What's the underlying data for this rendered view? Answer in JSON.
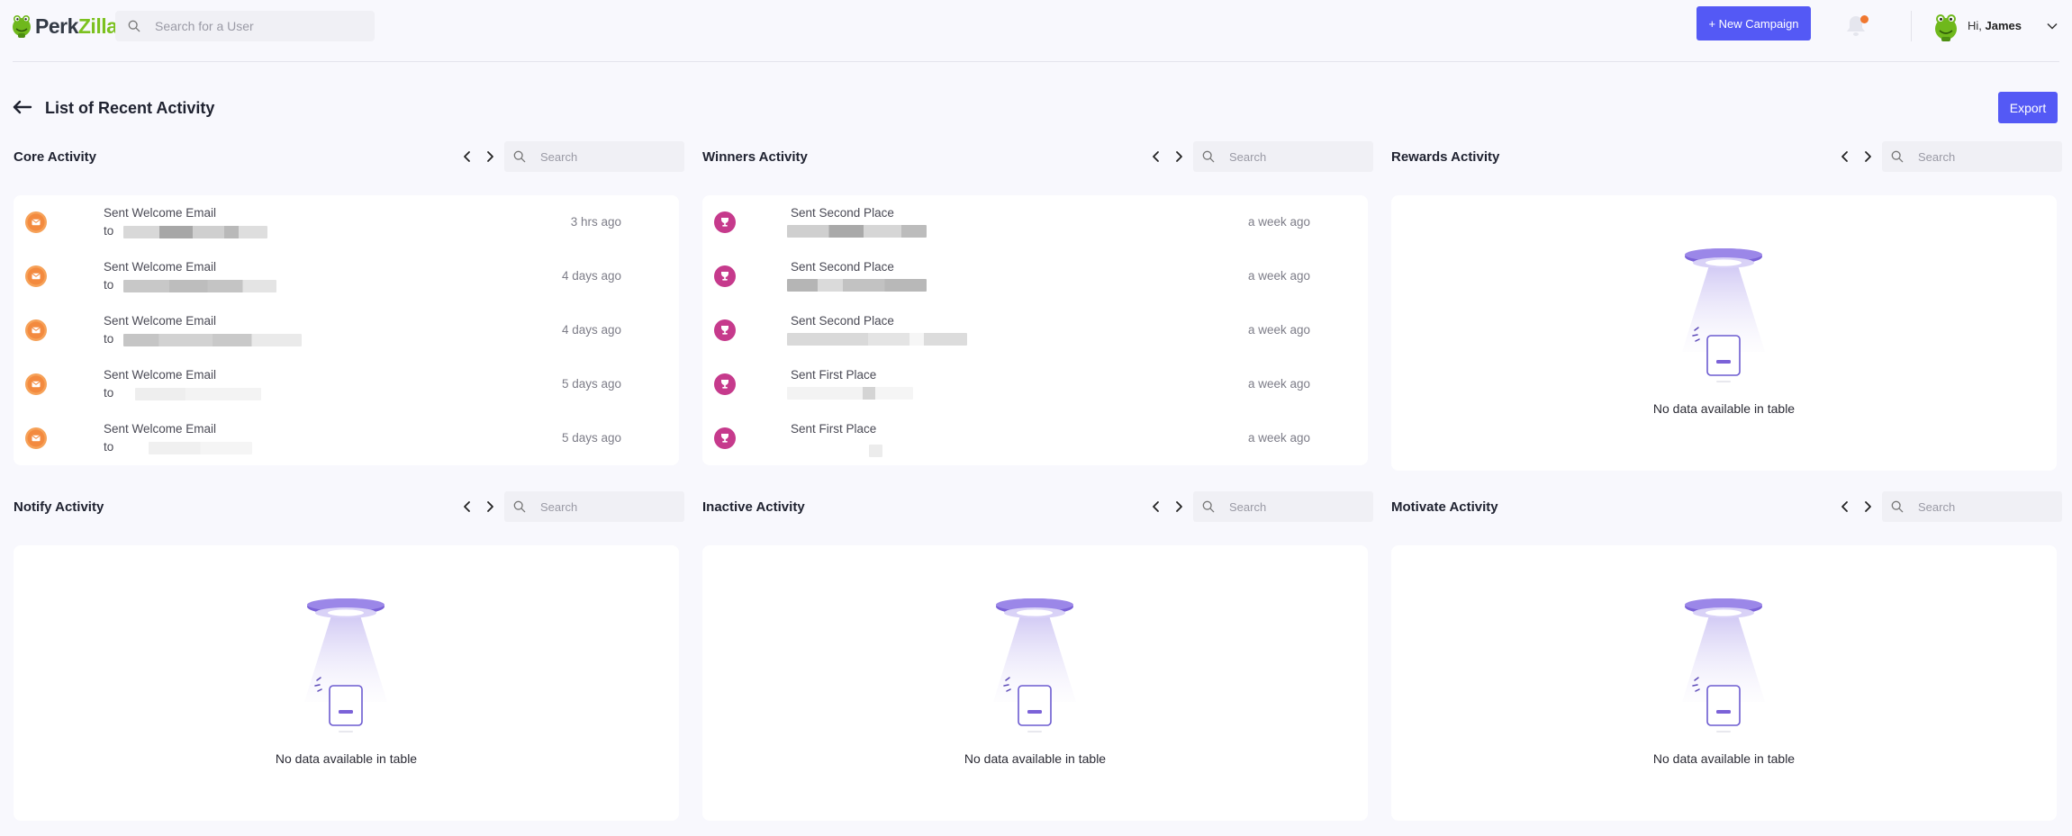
{
  "header": {
    "logo_part1": "Perk",
    "logo_part2": "Zilla",
    "search_placeholder": "Search for a User",
    "new_campaign_label": "+ New Campaign",
    "greeting": "Hi,",
    "user_name": "James",
    "accent_color": "#5459f5",
    "notification_dot_color": "#f0772f"
  },
  "page": {
    "title": "List of Recent Activity",
    "export_label": "Export"
  },
  "panels": {
    "core": {
      "title": "Core Activity",
      "search_placeholder": "Search",
      "badge_icon": "email-icon",
      "badge_color": "#f6a259",
      "rows": [
        {
          "title": "Sent Welcome Email",
          "sub": "to",
          "time": "3 hrs ago"
        },
        {
          "title": "Sent Welcome Email",
          "sub": "to",
          "time": "4 days ago"
        },
        {
          "title": "Sent Welcome Email",
          "sub": "to",
          "time": "4 days ago"
        },
        {
          "title": "Sent Welcome Email",
          "sub": "to",
          "time": "5 days ago"
        },
        {
          "title": "Sent Welcome Email",
          "sub": "to",
          "time": "5 days ago"
        }
      ]
    },
    "winners": {
      "title": "Winners Activity",
      "search_placeholder": "Search",
      "badge_icon": "trophy-icon",
      "badge_color": "#c63a8c",
      "rows": [
        {
          "title": "Sent Second Place",
          "time": "a week ago"
        },
        {
          "title": "Sent Second Place",
          "time": "a week ago"
        },
        {
          "title": "Sent Second Place",
          "time": "a week ago"
        },
        {
          "title": "Sent First Place",
          "time": "a week ago"
        },
        {
          "title": "Sent First Place",
          "time": "a week ago"
        }
      ]
    },
    "rewards": {
      "title": "Rewards Activity",
      "search_placeholder": "Search",
      "empty_text": "No data available in table"
    },
    "notify": {
      "title": "Notify Activity",
      "search_placeholder": "Search",
      "empty_text": "No data available in table"
    },
    "inactive": {
      "title": "Inactive Activity",
      "search_placeholder": "Search",
      "empty_text": "No data available in table"
    },
    "motivate": {
      "title": "Motivate Activity",
      "search_placeholder": "Search",
      "empty_text": "No data available in table"
    }
  }
}
